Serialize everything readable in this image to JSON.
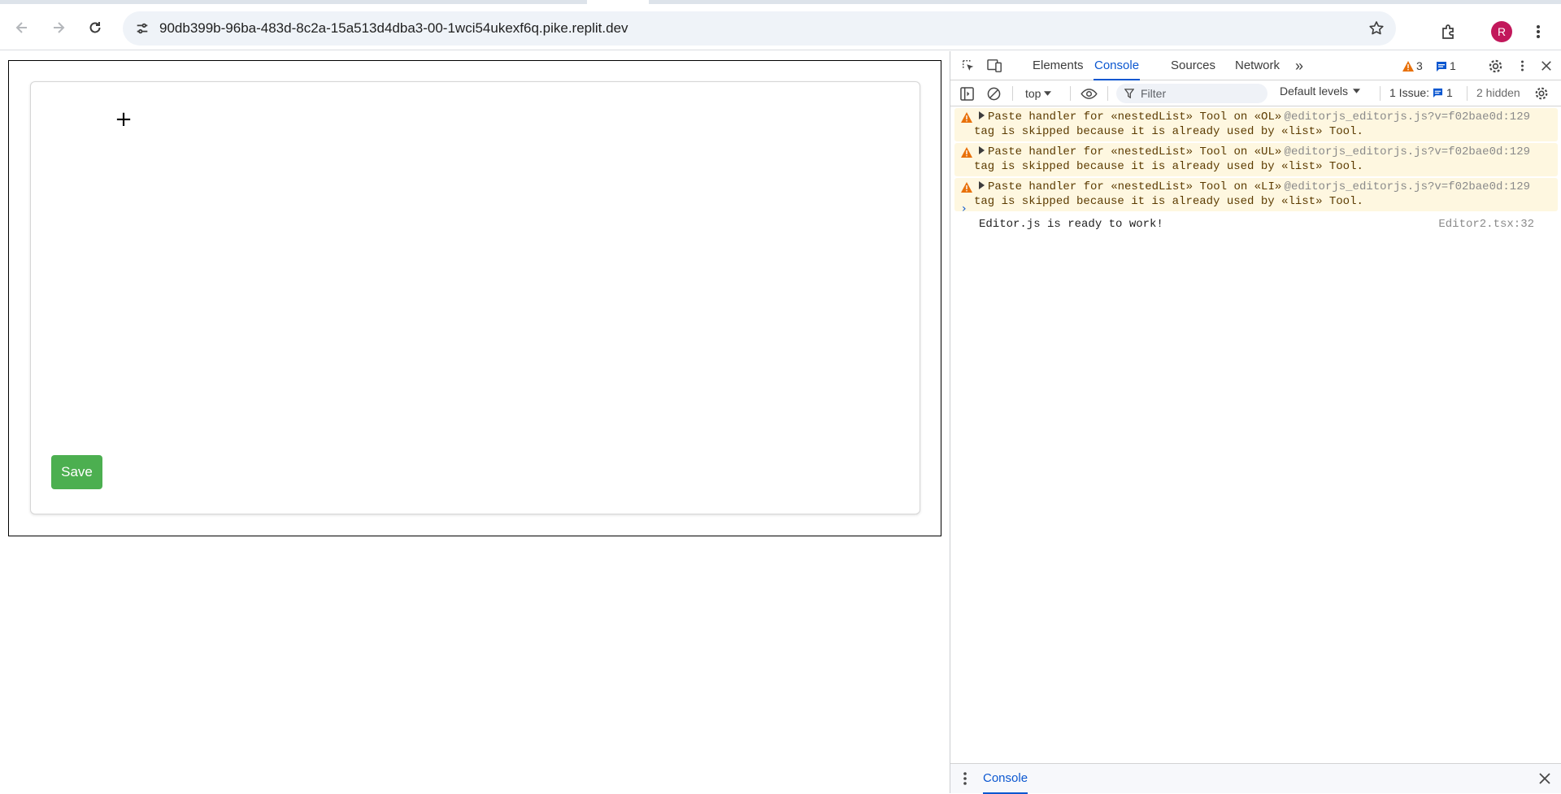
{
  "browser": {
    "url": "90db399b-96ba-483d-8c2a-15a513d4dba3-00-1wci54ukexf6q.pike.replit.dev",
    "profile_initial": "R",
    "icons": {
      "back": "back-arrow-icon",
      "forward": "forward-arrow-icon",
      "reload": "reload-icon",
      "site_info": "tune-icon",
      "bookmark": "star-icon",
      "extensions": "puzzle-icon",
      "menu": "kebab-menu-icon"
    }
  },
  "page": {
    "plus_symbol": "+",
    "save_label": "Save",
    "save_color": "#4caf50"
  },
  "devtools": {
    "tabs": [
      "Elements",
      "Console",
      "Sources",
      "Network"
    ],
    "active_tab": "Console",
    "more_tabs": "»",
    "warning_count": "3",
    "message_count": "1",
    "context": "top",
    "filter_placeholder": "Filter",
    "levels": "Default levels",
    "issues_label": "1 Issue:",
    "issues_count": "1",
    "hidden": "2 hidden",
    "messages": [
      {
        "type": "warning",
        "line1": "Paste handler for «nestedList» Tool on «OL»",
        "line2": "tag is skipped because it is already used by «list» Tool.",
        "source": "@editorjs_editorjs.js?v=f02bae0d:129"
      },
      {
        "type": "warning",
        "line1": "Paste handler for «nestedList» Tool on «UL»",
        "line2": "tag is skipped because it is already used by «list» Tool.",
        "source": "@editorjs_editorjs.js?v=f02bae0d:129"
      },
      {
        "type": "warning",
        "line1": "Paste handler for «nestedList» Tool on «LI»",
        "line2": "tag is skipped because it is already used by «list» Tool.",
        "source": "@editorjs_editorjs.js?v=f02bae0d:129"
      },
      {
        "type": "log",
        "text": "Editor.js is ready to work!",
        "source": "Editor2.tsx:32"
      }
    ],
    "prompt": "›",
    "drawer_tab": "Console"
  }
}
